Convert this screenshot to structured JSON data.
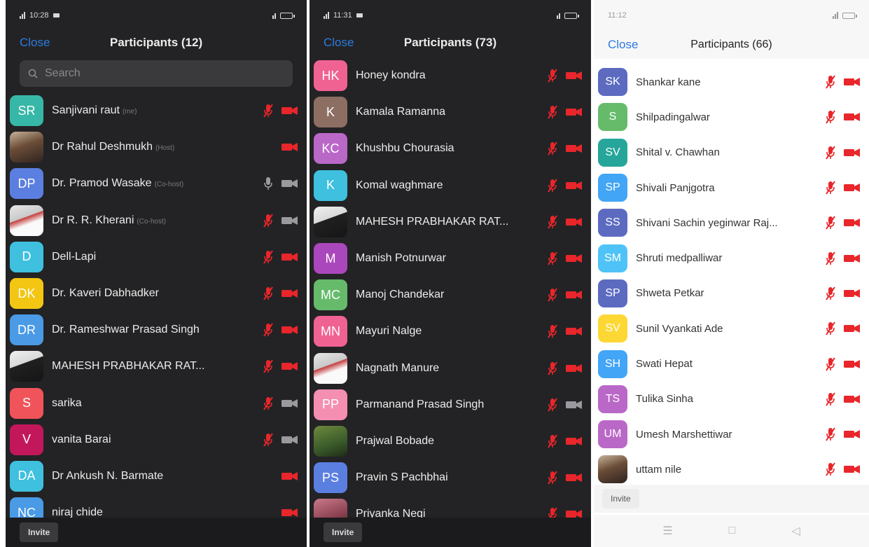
{
  "colors": {
    "accent": "#2d7be0",
    "muted_red": "#e8262b",
    "dark_bg": "#232325"
  },
  "panels": [
    {
      "status_time": "10:28",
      "close_label": "Close",
      "title": "Participants (12)",
      "search_placeholder": "Search",
      "invite_label": "Invite",
      "participants": [
        {
          "initials": "SR",
          "color": "#37b7a7",
          "name": "Sanjivani raut",
          "role": "(me)",
          "mic": "muted",
          "video": "off"
        },
        {
          "initials": "",
          "color": "",
          "photo": "p1",
          "name": "Dr Rahul Deshmukh",
          "role": "(Host)",
          "mic": "none",
          "video": "off"
        },
        {
          "initials": "DP",
          "color": "#5b7fe0",
          "name": "Dr. Pramod Wasake",
          "role": "(Co-host)",
          "mic": "on",
          "video": "on"
        },
        {
          "initials": "",
          "color": "",
          "photo": "p5",
          "name": "Dr R. R. Kherani",
          "role": "(Co-host)",
          "mic": "muted",
          "video": "on"
        },
        {
          "initials": "D",
          "color": "#3ec0de",
          "name": "Dell-Lapi",
          "role": "",
          "mic": "muted",
          "video": "off"
        },
        {
          "initials": "DK",
          "color": "#f2c612",
          "name": "Dr. Kaveri Dabhadker",
          "role": "",
          "mic": "muted",
          "video": "off"
        },
        {
          "initials": "DR",
          "color": "#4a9ae6",
          "name": "Dr. Rameshwar Prasad Singh",
          "role": "",
          "mic": "muted",
          "video": "off"
        },
        {
          "initials": "",
          "color": "",
          "photo": "p2",
          "name": "MAHESH PRABHAKAR RAT...",
          "role": "",
          "mic": "muted",
          "video": "off"
        },
        {
          "initials": "S",
          "color": "#f0545a",
          "name": "sarika",
          "role": "",
          "mic": "muted",
          "video": "on"
        },
        {
          "initials": "V",
          "color": "#c2185b",
          "name": "vanita Barai",
          "role": "",
          "mic": "muted",
          "video": "on"
        },
        {
          "initials": "DA",
          "color": "#3ec0de",
          "name": "Dr Ankush N. Barmate",
          "role": "",
          "mic": "none",
          "video": "off"
        },
        {
          "initials": "NC",
          "color": "#4a9ae6",
          "name": "niraj chide",
          "role": "",
          "mic": "none",
          "video": "off"
        }
      ]
    },
    {
      "status_time": "11:31",
      "close_label": "Close",
      "title": "Participants (73)",
      "invite_label": "Invite",
      "participants": [
        {
          "initials": "HK",
          "color": "#f06292",
          "name": "Honey kondra",
          "mic": "muted",
          "video": "off"
        },
        {
          "initials": "K",
          "color": "#8d6e63",
          "name": "Kamala Ramanna",
          "mic": "muted",
          "video": "off"
        },
        {
          "initials": "KC",
          "color": "#ba68c8",
          "name": "Khushbu Chourasia",
          "mic": "muted",
          "video": "off"
        },
        {
          "initials": "K",
          "color": "#3ec0de",
          "name": "Komal  waghmare",
          "mic": "muted",
          "video": "off"
        },
        {
          "initials": "",
          "color": "",
          "photo": "p2",
          "name": "MAHESH PRABHAKAR RAT...",
          "mic": "muted",
          "video": "off"
        },
        {
          "initials": "M",
          "color": "#ab47bc",
          "name": "Manish Potnurwar",
          "mic": "muted",
          "video": "off"
        },
        {
          "initials": "MC",
          "color": "#66bb6a",
          "name": "Manoj Chandekar",
          "mic": "muted",
          "video": "off"
        },
        {
          "initials": "MN",
          "color": "#f06292",
          "name": "Mayuri Nalge",
          "mic": "muted",
          "video": "off"
        },
        {
          "initials": "",
          "color": "",
          "photo": "p5",
          "name": "Nagnath Manure",
          "mic": "muted",
          "video": "off"
        },
        {
          "initials": "PP",
          "color": "#f48fb1",
          "name": "Parmanand Prasad Singh",
          "mic": "muted",
          "video": "on"
        },
        {
          "initials": "",
          "color": "",
          "photo": "p3",
          "name": "Prajwal Bobade",
          "mic": "muted",
          "video": "off"
        },
        {
          "initials": "PS",
          "color": "#5b7fe0",
          "name": "Pravin S Pachbhai",
          "mic": "muted",
          "video": "off"
        },
        {
          "initials": "",
          "color": "",
          "photo": "p4",
          "name": "Priyanka Negi",
          "mic": "muted",
          "video": "off"
        }
      ]
    },
    {
      "status_time": "11:12",
      "close_label": "Close",
      "title": "Participants (66)",
      "invite_label": "Invite",
      "participants": [
        {
          "initials": "SK",
          "color": "#5c6bc0",
          "name": "Shankar kane",
          "mic": "muted",
          "video": "off"
        },
        {
          "initials": "S",
          "color": "#66bb6a",
          "name": "Shilpadingalwar",
          "mic": "muted",
          "video": "off"
        },
        {
          "initials": "SV",
          "color": "#26a69a",
          "name": "Shital v. Chawhan",
          "mic": "muted",
          "video": "off"
        },
        {
          "initials": "SP",
          "color": "#42a5f5",
          "name": "Shivali Panjgotra",
          "mic": "muted",
          "video": "off"
        },
        {
          "initials": "SS",
          "color": "#5c6bc0",
          "name": "Shivani Sachin yeginwar Raj...",
          "mic": "muted",
          "video": "off"
        },
        {
          "initials": "SM",
          "color": "#4fc3f7",
          "name": "Shruti medpalliwar",
          "mic": "muted",
          "video": "off"
        },
        {
          "initials": "SP",
          "color": "#5c6bc0",
          "name": "Shweta Petkar",
          "mic": "muted",
          "video": "off"
        },
        {
          "initials": "SV",
          "color": "#fdd835",
          "name": "Sunil Vyankati Ade",
          "mic": "muted",
          "video": "off"
        },
        {
          "initials": "SH",
          "color": "#42a5f5",
          "name": "Swati Hepat",
          "mic": "muted",
          "video": "off"
        },
        {
          "initials": "TS",
          "color": "#ba68c8",
          "name": "Tulika Sinha",
          "mic": "muted",
          "video": "off"
        },
        {
          "initials": "UM",
          "color": "#ba68c8",
          "name": "Umesh Marshettiwar",
          "mic": "muted",
          "video": "off"
        },
        {
          "initials": "",
          "color": "",
          "photo": "p1",
          "name": "uttam nile",
          "mic": "muted",
          "video": "off"
        }
      ]
    }
  ]
}
